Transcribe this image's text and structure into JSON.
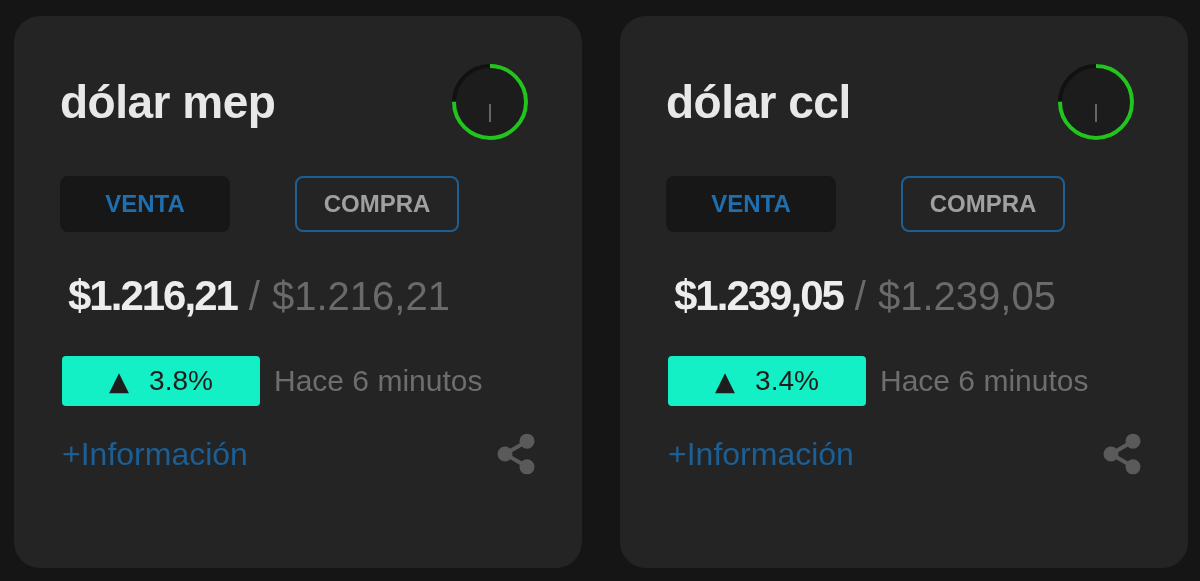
{
  "cards": [
    {
      "title": "dólar mep",
      "tabs": [
        {
          "label": "VENTA",
          "selected": true
        },
        {
          "label": "COMPRA",
          "selected": false
        }
      ],
      "price_main": "$1.216,21",
      "separator": "/",
      "price_secondary": "$1.216,21",
      "change": {
        "arrow": "▲",
        "value": "3.8%"
      },
      "updated": "Hace 6 minutos",
      "link": "+Información"
    },
    {
      "title": "dólar ccl",
      "tabs": [
        {
          "label": "VENTA",
          "selected": true
        },
        {
          "label": "COMPRA",
          "selected": false
        }
      ],
      "price_main": "$1.239,05",
      "separator": "/",
      "price_secondary": "$1.239,05",
      "change": {
        "arrow": "▲",
        "value": "3.4%"
      },
      "updated": "Hace 6 minutos",
      "link": "+Información"
    }
  ]
}
